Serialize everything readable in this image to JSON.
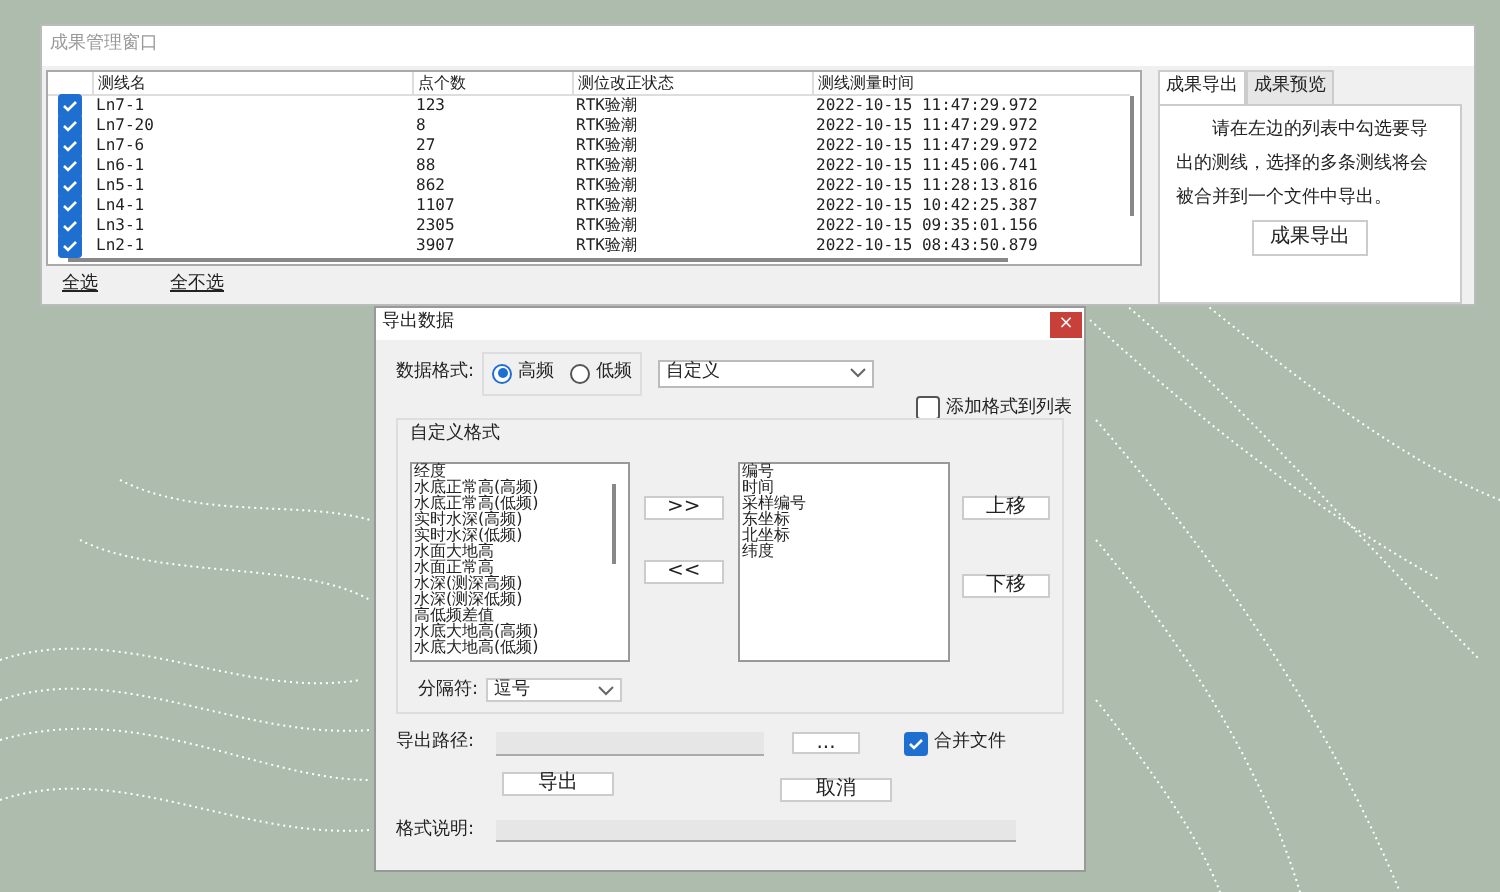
{
  "main_window": {
    "title": "成果管理窗口",
    "table": {
      "columns": [
        "测线名",
        "点个数",
        "测位改正状态",
        "测线测量时间"
      ],
      "rows": [
        {
          "checked": true,
          "cells": [
            "Ln7-1",
            "123",
            "RTK验潮",
            "2022-10-15 11:47:29.972"
          ]
        },
        {
          "checked": true,
          "cells": [
            "Ln7-20",
            "8",
            "RTK验潮",
            "2022-10-15 11:47:29.972"
          ]
        },
        {
          "checked": true,
          "cells": [
            "Ln7-6",
            "27",
            "RTK验潮",
            "2022-10-15 11:47:29.972"
          ]
        },
        {
          "checked": true,
          "cells": [
            "Ln6-1",
            "88",
            "RTK验潮",
            "2022-10-15 11:45:06.741"
          ]
        },
        {
          "checked": true,
          "cells": [
            "Ln5-1",
            "862",
            "RTK验潮",
            "2022-10-15 11:28:13.816"
          ]
        },
        {
          "checked": true,
          "cells": [
            "Ln4-1",
            "1107",
            "RTK验潮",
            "2022-10-15 10:42:25.387"
          ]
        },
        {
          "checked": true,
          "cells": [
            "Ln3-1",
            "2305",
            "RTK验潮",
            "2022-10-15 09:35:01.156"
          ]
        },
        {
          "checked": true,
          "cells": [
            "Ln2-1",
            "3907",
            "RTK验潮",
            "2022-10-15 08:43:50.879"
          ]
        }
      ]
    },
    "links": [
      "全选",
      "全不选"
    ],
    "tabs": [
      {
        "label": "成果导出",
        "selected": true
      },
      {
        "label": "成果预览",
        "selected": false
      }
    ],
    "info": "请在左边的列表中勾选要导出的测线，选择的多条测线将会被合并到一个文件中导出。",
    "export_button": "成果导出"
  },
  "dialog": {
    "title": "导出数据",
    "close": "×",
    "format_label": "数据格式:",
    "radios": [
      {
        "label": "高频",
        "selected": true
      },
      {
        "label": "低频",
        "selected": false
      }
    ],
    "format_select": "自定义",
    "add_to_list": {
      "label": "添加格式到列表",
      "checked": false
    },
    "group_title": "自定义格式",
    "available_fields": [
      "经度",
      "水底正常高(高频)",
      "水底正常高(低频)",
      "实时水深(高频)",
      "实时水深(低频)",
      "水面大地高",
      "水面正常高",
      "水深(测深高频)",
      "水深(测深低频)",
      "高低频差值",
      "水底大地高(高频)",
      "水底大地高(低频)"
    ],
    "add_button": ">>",
    "remove_button": "<<",
    "selected_fields": [
      "编号",
      "时间",
      "采样编号",
      "东坐标",
      "北坐标",
      "纬度"
    ],
    "up_button": "上移",
    "down_button": "下移",
    "separator_label": "分隔符:",
    "separator_select": "逗号",
    "path_label": "导出路径:",
    "browse_button": "...",
    "merge": {
      "label": "合并文件",
      "checked": true
    },
    "export_button": "导出",
    "cancel_button": "取消",
    "desc_label": "格式说明:"
  }
}
